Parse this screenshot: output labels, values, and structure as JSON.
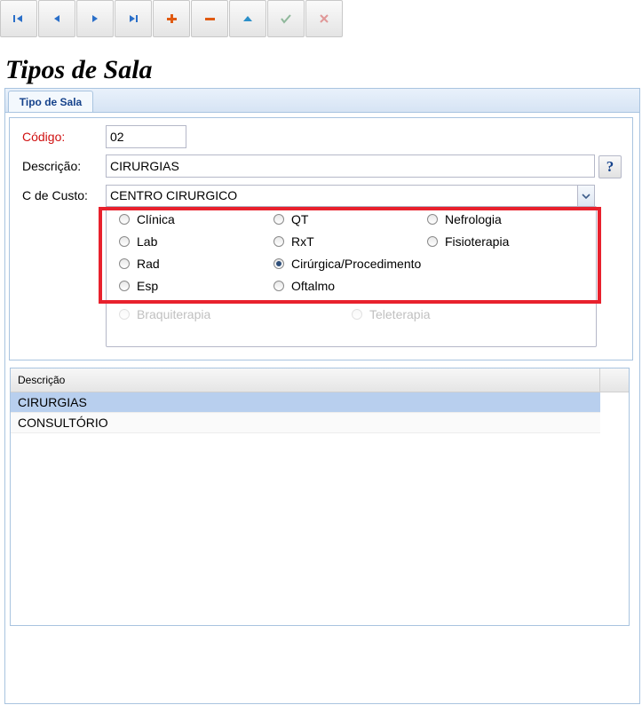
{
  "toolbar": {
    "buttons": [
      {
        "name": "first-record-button",
        "icon": "first-icon"
      },
      {
        "name": "prev-record-button",
        "icon": "prev-icon"
      },
      {
        "name": "next-record-button",
        "icon": "next-icon"
      },
      {
        "name": "last-record-button",
        "icon": "last-icon"
      },
      {
        "name": "add-button",
        "icon": "plus-icon"
      },
      {
        "name": "delete-button",
        "icon": "minus-icon"
      },
      {
        "name": "edit-button",
        "icon": "triangle-up-icon"
      },
      {
        "name": "confirm-button",
        "icon": "check-icon"
      },
      {
        "name": "cancel-button",
        "icon": "close-icon"
      }
    ]
  },
  "page": {
    "title": "Tipos de Sala"
  },
  "tab": {
    "label": "Tipo de Sala"
  },
  "form": {
    "codigo_label": "Código:",
    "codigo_value": "02",
    "descricao_label": "Descrição:",
    "descricao_value": "CIRURGIAS",
    "help_label": "?",
    "custo_label": "C de Custo:",
    "custo_value": "CENTRO CIRURGICO"
  },
  "radios": {
    "clinica": "Clínica",
    "qt": "QT",
    "nefrologia": "Nefrologia",
    "lab": "Lab",
    "rxt": "RxT",
    "fisioterapia": "Fisioterapia",
    "rad": "Rad",
    "cirurgica": "Cirúrgica/Procedimento",
    "esp": "Esp",
    "oftalmo": "Oftalmo",
    "braquiterapia": "Braquiterapia",
    "teleterapia": "Teleterapia",
    "selected": "Cirúrgica/Procedimento"
  },
  "grid": {
    "header": "Descrição",
    "rows": [
      "CIRURGIAS",
      "CONSULTÓRIO"
    ]
  },
  "colors": {
    "accent": "#15428b",
    "highlight": "#e8212d",
    "selected_row": "#b8cfee",
    "required": "#d01010"
  }
}
